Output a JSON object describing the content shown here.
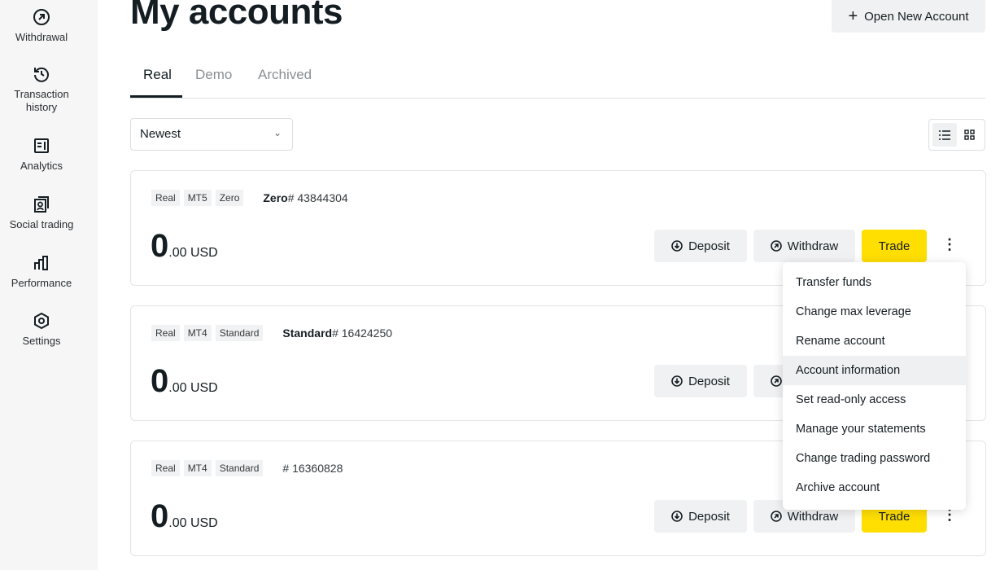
{
  "sidebar": {
    "items": [
      {
        "label": "Withdrawal",
        "icon": "arrow-up-right-circle-icon"
      },
      {
        "label": "Transaction history",
        "icon": "history-icon"
      },
      {
        "label": "Analytics",
        "icon": "analytics-icon"
      },
      {
        "label": "Social trading",
        "icon": "social-trading-icon"
      },
      {
        "label": "Performance",
        "icon": "bar-chart-icon"
      },
      {
        "label": "Settings",
        "icon": "settings-hexagon-icon"
      }
    ]
  },
  "header": {
    "title": "My accounts",
    "new_account_label": "Open New Account"
  },
  "tabs": [
    {
      "label": "Real",
      "active": true
    },
    {
      "label": "Demo"
    },
    {
      "label": "Archived"
    }
  ],
  "sort": {
    "value": "Newest"
  },
  "accounts": [
    {
      "badges": [
        "Real",
        "MT5",
        "Zero"
      ],
      "name": "Zero",
      "number": "# 43844304",
      "balance_int": "0",
      "balance_rest": ".00 USD"
    },
    {
      "badges": [
        "Real",
        "MT4",
        "Standard"
      ],
      "name": "Standard",
      "number": "# 16424250",
      "balance_int": "0",
      "balance_rest": ".00 USD"
    },
    {
      "badges": [
        "Real",
        "MT4",
        "Standard"
      ],
      "name": "",
      "number": "# 16360828",
      "balance_int": "0",
      "balance_rest": ".00 USD"
    }
  ],
  "actions": {
    "deposit": "Deposit",
    "withdraw": "Withdraw",
    "trade": "Trade"
  },
  "menu": {
    "items": [
      "Transfer funds",
      "Change max leverage",
      "Rename account",
      "Account information",
      "Set read-only access",
      "Manage your statements",
      "Change trading password",
      "Archive account"
    ],
    "highlighted": "Account information"
  },
  "colors": {
    "trade": "#ffde02",
    "sidebar": "#f6f6f6"
  }
}
